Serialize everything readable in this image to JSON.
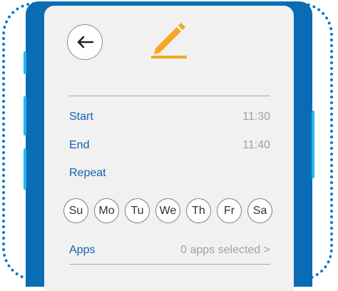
{
  "header": {
    "back_icon": "arrow-left-icon",
    "edit_icon": "pencil-icon",
    "accent_color": "#f5a623"
  },
  "schedule": {
    "start_label": "Start",
    "start_value": "11:30",
    "end_label": "End",
    "end_value": "11:40",
    "repeat_label": "Repeat"
  },
  "days": [
    "Su",
    "Mo",
    "Tu",
    "We",
    "Th",
    "Fr",
    "Sa"
  ],
  "apps": {
    "label": "Apps",
    "value": "0 apps selected >"
  },
  "colors": {
    "phone_body": "#0a6cb5",
    "side_buttons": "#1fb8f0",
    "label_blue": "#1660b0"
  }
}
